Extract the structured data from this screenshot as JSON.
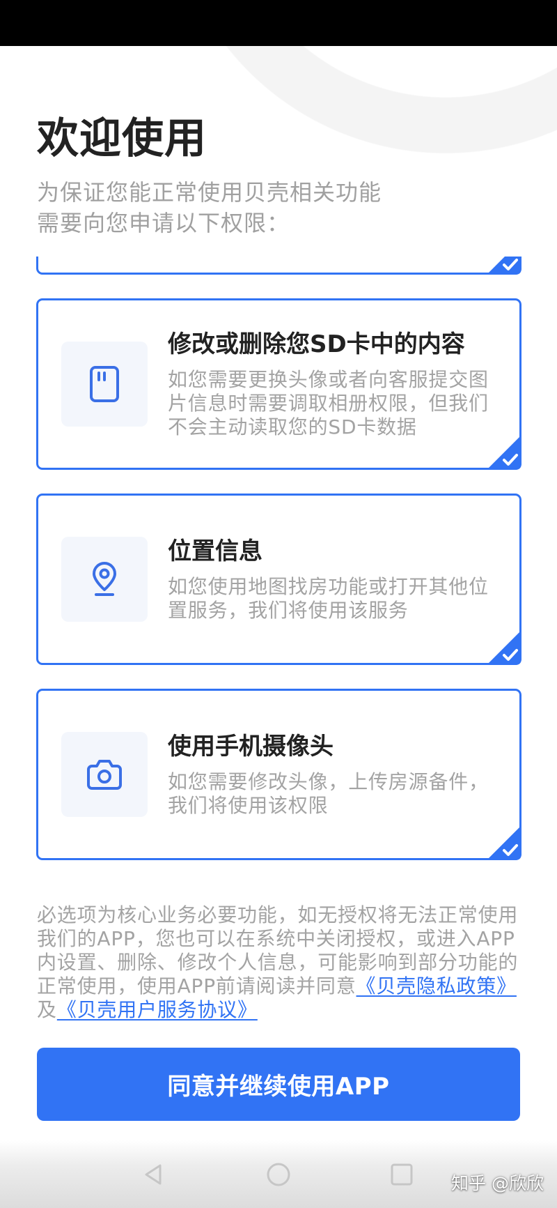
{
  "colors": {
    "accent": "#3173F4",
    "icon": "#3A6FE6",
    "title": "#222222",
    "muted": "#A3A3A3",
    "icon_bg": "#F3F6FC"
  },
  "header": {
    "title": "欢迎使用",
    "subtitle_lines": [
      "为保证您能正常使用贝壳相关功能",
      "需要向您申请以下权限："
    ]
  },
  "permissions": [
    {
      "icon": "sd-card-icon",
      "title": "修改或删除您SD卡中的内容",
      "description": "如您需要更换头像或者向客服提交图片信息时需要调取相册权限，但我们不会主动读取您的SD卡数据",
      "checked": true
    },
    {
      "icon": "location-pin-icon",
      "title": "位置信息",
      "description": "如您使用地图找房功能或打开其他位置服务，我们将使用该服务",
      "checked": true
    },
    {
      "icon": "camera-icon",
      "title": "使用手机摄像头",
      "description": "如您需要修改头像，上传房源备件，我们将使用该权限",
      "checked": true
    }
  ],
  "footer": {
    "notice": "必选项为核心业务必要功能，如无授权将无法正常使用我们的APP，您也可以在系统中关闭授权，或进入APP内设置、删除、修改个人信息，可能影响到部分功能的正常使用，使用APP前请阅读并同意",
    "privacy_link": "《贝壳隐私政策》",
    "conjunction": "及",
    "terms_link": "《贝壳用户服务协议》"
  },
  "agree_button": {
    "label": "同意并继续使用APP"
  },
  "nav_bar": {
    "buttons": [
      "back-icon",
      "home-icon",
      "recents-icon"
    ]
  },
  "watermark": "知乎 @欣欣"
}
